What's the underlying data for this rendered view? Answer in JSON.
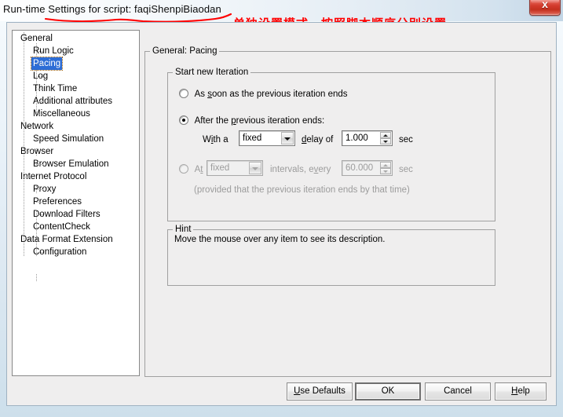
{
  "window": {
    "title": "Run-time Settings for script: faqiShenpiBiaodan",
    "close_glyph": "x",
    "close_color": "#d23a2c"
  },
  "annotations": {
    "title_note": "单独设置模式，按照脚本顺序分别设置",
    "color": "#ff0000"
  },
  "tree": {
    "selected": "Pacing",
    "highlight_color": "#2d6dd6",
    "items": [
      {
        "label": "General",
        "level": 1
      },
      {
        "label": "Run Logic",
        "level": 2
      },
      {
        "label": "Pacing",
        "level": 2
      },
      {
        "label": "Log",
        "level": 2
      },
      {
        "label": "Think Time",
        "level": 2
      },
      {
        "label": "Additional attributes",
        "level": 2
      },
      {
        "label": "Miscellaneous",
        "level": 2
      },
      {
        "label": "Network",
        "level": 1
      },
      {
        "label": "Speed Simulation",
        "level": 2
      },
      {
        "label": "Browser",
        "level": 1
      },
      {
        "label": "Browser Emulation",
        "level": 2
      },
      {
        "label": "Internet Protocol",
        "level": 1
      },
      {
        "label": "Proxy",
        "level": 2
      },
      {
        "label": "Preferences",
        "level": 2
      },
      {
        "label": "Download Filters",
        "level": 2
      },
      {
        "label": "ContentCheck",
        "level": 2
      },
      {
        "label": "Data Format Extension",
        "level": 1
      },
      {
        "label": "Configuration",
        "level": 2
      }
    ]
  },
  "pane": {
    "group_title": "General: Pacing",
    "start_group_title": "Start new Iteration",
    "option1": {
      "label_pre": "As ",
      "label_accel": "s",
      "label_post": "oon as the previous iteration ends",
      "selected": false
    },
    "option2": {
      "label_pre": "After the ",
      "label_accel": "p",
      "label_post": "revious iteration ends:",
      "selected": true,
      "with_a_pre": "W",
      "with_a_accel": "i",
      "with_a_post": "th a",
      "combo_value": "fixed",
      "delay_pre": "",
      "delay_accel": "d",
      "delay_post": "elay of",
      "spin_value": "1.000",
      "unit": "sec"
    },
    "option3": {
      "label_pre": "A",
      "label_accel": "t",
      "label_post": "",
      "selected": false,
      "enabled": false,
      "combo_value": "fixed",
      "mid_pre": "intervals, e",
      "mid_accel": "v",
      "mid_post": "ery",
      "spin_value": "60.000",
      "unit": "sec",
      "note": "(provided that the previous iteration ends by that time)"
    },
    "hint_group_title": "Hint",
    "hint_text": "Move the mouse over any item to see its description."
  },
  "buttons": {
    "use_defaults": {
      "pre": "U",
      "accel": "U",
      "post": "se Defaults",
      "label": "Use Defaults"
    },
    "ok": {
      "label": "OK"
    },
    "cancel": {
      "label": "Cancel"
    },
    "help": {
      "pre": "",
      "accel": "H",
      "post": "elp",
      "label": "Help"
    }
  }
}
